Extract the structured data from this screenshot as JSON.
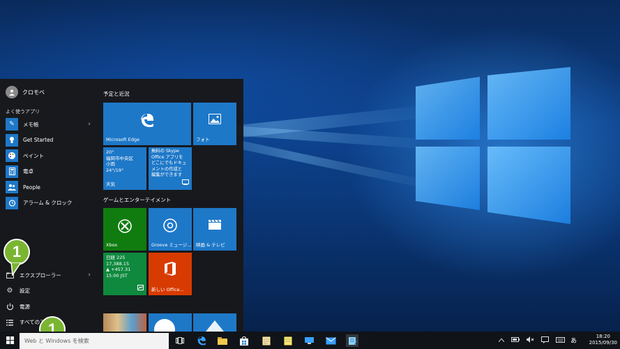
{
  "start_menu": {
    "user_name": "クロモベ",
    "frequent_header": "よく使うアプリ",
    "apps": [
      {
        "label": "メモ帳",
        "icon": "notepad-icon",
        "color": "#2d7dd2",
        "glyph": "✎",
        "chevron": true
      },
      {
        "label": "Get Started",
        "icon": "lightbulb-icon",
        "color": "#1e78c8",
        "glyph": "💡",
        "chevron": false
      },
      {
        "label": "ペイント",
        "icon": "paint-icon",
        "color": "#1e78c8",
        "glyph": "🎨",
        "chevron": false
      },
      {
        "label": "電卓",
        "icon": "calculator-icon",
        "color": "#1e78c8",
        "glyph": "▦",
        "chevron": false
      },
      {
        "label": "People",
        "icon": "people-icon",
        "color": "#1e78c8",
        "glyph": "👥",
        "chevron": false
      },
      {
        "label": "アラーム & クロック",
        "icon": "alarm-clock-icon",
        "color": "#1e78c8",
        "glyph": "⏰",
        "chevron": false
      }
    ],
    "bottom": [
      {
        "label": "エクスプローラー",
        "icon": "file-explorer-icon",
        "glyph": "🗀",
        "chevron": true
      },
      {
        "label": "設定",
        "icon": "settings-gear-icon",
        "glyph": "⚙",
        "chevron": false
      },
      {
        "label": "電源",
        "icon": "power-icon",
        "glyph": "⏻",
        "chevron": false
      },
      {
        "label": "すべてのアプリ",
        "icon": "all-apps-icon",
        "glyph": "☰",
        "chevron": false
      }
    ]
  },
  "tiles": {
    "group1_title": "予定と近況",
    "group2_title": "ゲームとエンターテイメント",
    "edge_label": "Microsoft Edge",
    "photos_label": "フォト",
    "weather": {
      "temp": "20°",
      "location": "福岡市中央区",
      "condition": "小雨",
      "range": "24°/19°",
      "label": "天気"
    },
    "office_promo": {
      "line1": "無料の Skype",
      "line2": "Office アプリを",
      "line3": "どこにでもドキュ",
      "line4": "メントの作成と",
      "line5": "編集ができます"
    },
    "xbox_label": "Xbox",
    "groove_label": "Groove ミュージ...",
    "movies_label": "映画 & テレビ",
    "money": {
      "title": "日経 225",
      "value": "17,388.15",
      "change": "▲ +457.31",
      "time": "15:00 JST"
    },
    "office_label": "新しい Office..."
  },
  "badges": {
    "num1": "1",
    "num2": "1"
  },
  "taskbar": {
    "search_placeholder": "Web と Windows を検索",
    "ime": "あ",
    "time": "18:20",
    "date": "2015/09/30"
  },
  "colors": {
    "accent": "#1e78c8",
    "xbox": "#107c10",
    "money": "#0f893e",
    "office": "#d83b01",
    "badge": "#7ab532"
  }
}
